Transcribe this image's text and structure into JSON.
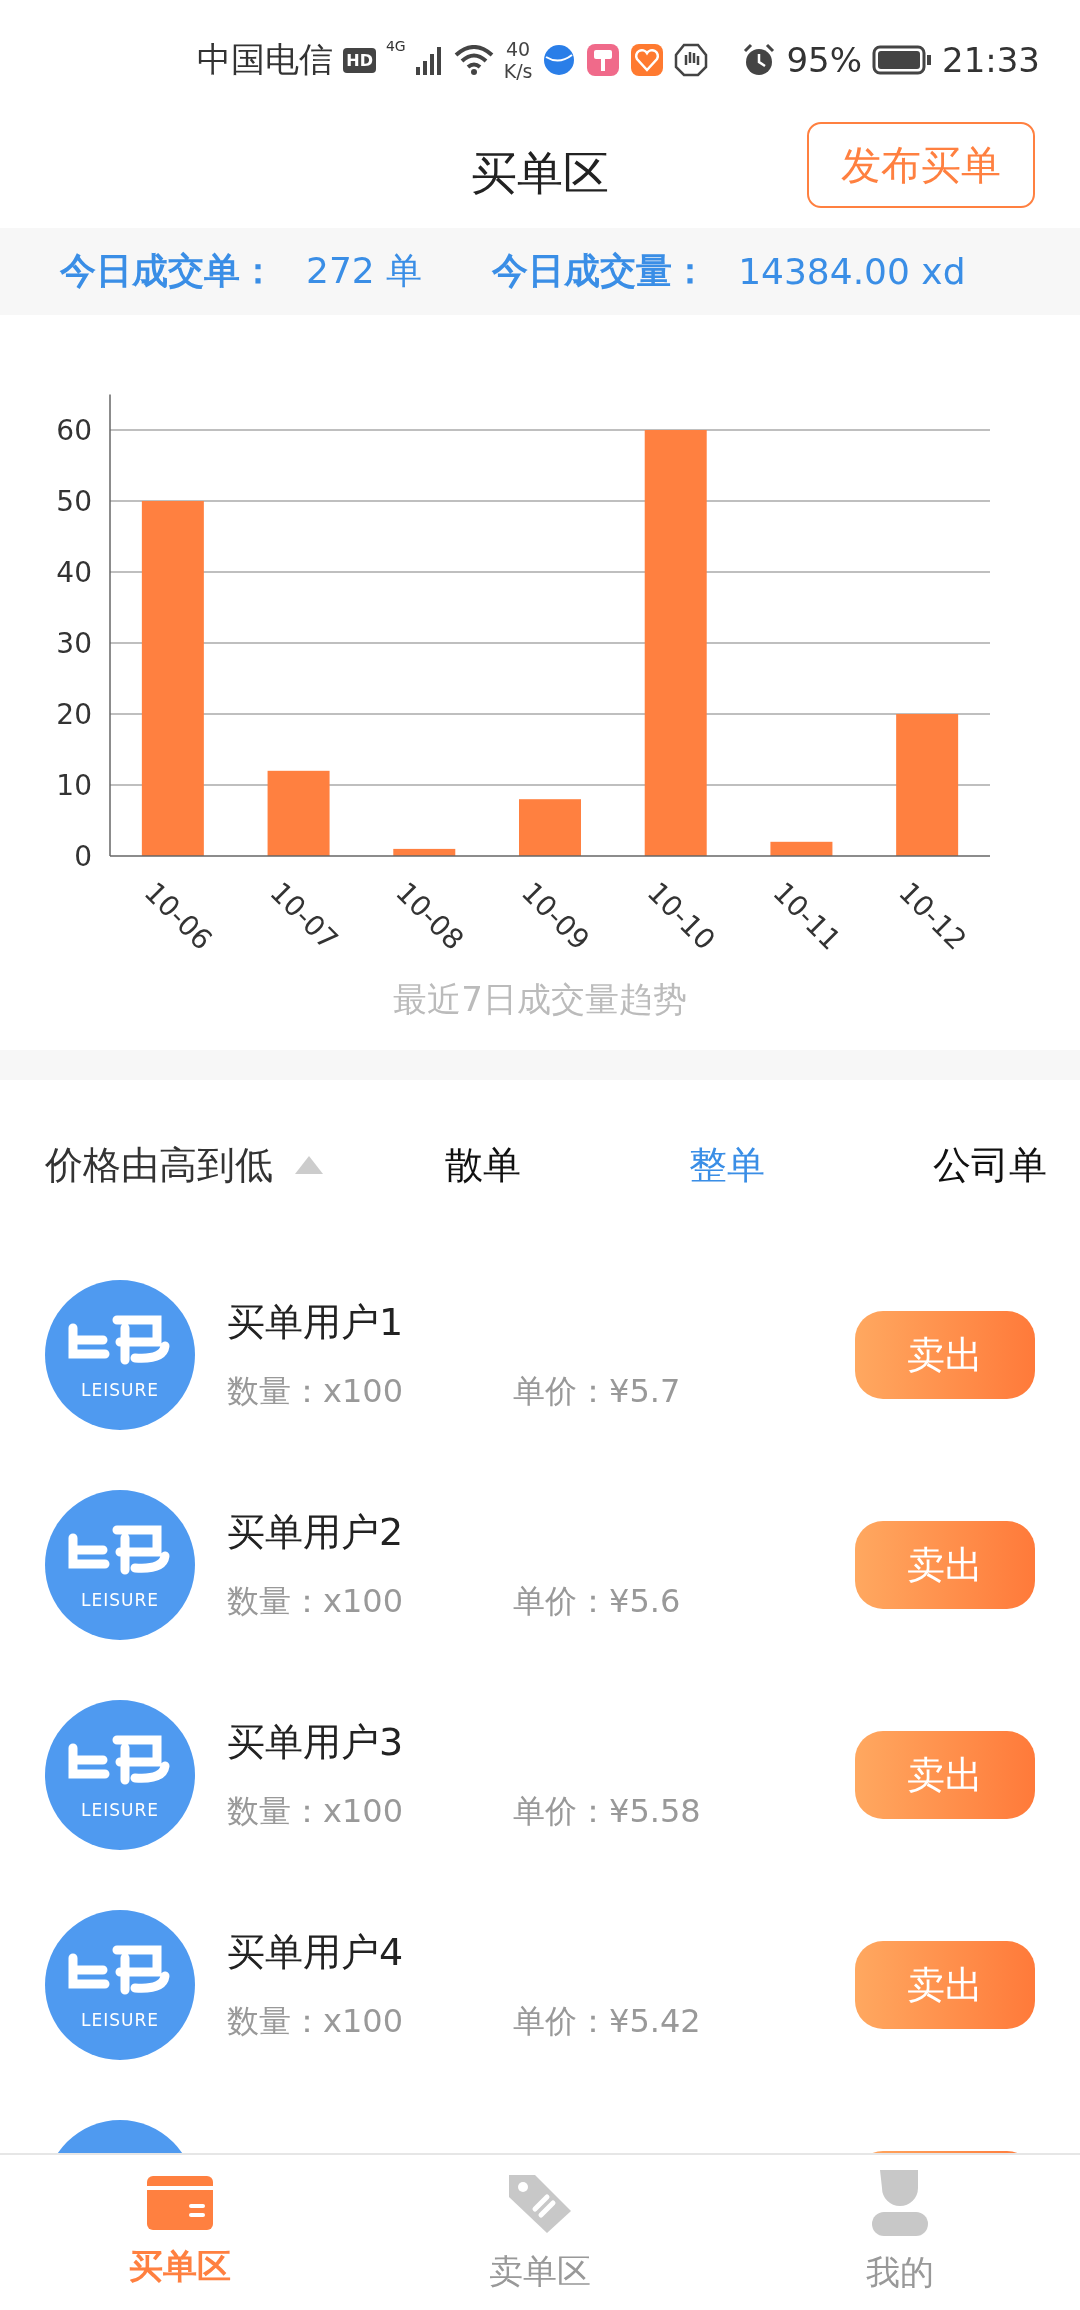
{
  "status_bar": {
    "carrier": "中国电信",
    "hd": "HD",
    "network": "4G",
    "speed_value": "40",
    "speed_unit": "K/s",
    "battery": "95%",
    "time": "21:33"
  },
  "header": {
    "title": "买单区",
    "action": "发布买单"
  },
  "stats": [
    {
      "label": "今日成交单：",
      "value": "272 单"
    },
    {
      "label": "今日成交量：",
      "value": "14384.00 xd"
    }
  ],
  "chart": {
    "caption": "最近7日成交量趋势",
    "chart_data": {
      "type": "bar",
      "categories": [
        "10-06",
        "10-07",
        "10-08",
        "10-09",
        "10-10",
        "10-11",
        "10-12"
      ],
      "series": [
        {
          "color": "#ff8040",
          "values": [
            50,
            12,
            1,
            8,
            60,
            2,
            20
          ]
        }
      ],
      "ylim": [
        0,
        65
      ],
      "grid": true,
      "yticks": [
        0,
        10,
        20,
        30,
        40,
        50,
        60
      ]
    }
  },
  "filters": {
    "sort": {
      "label": "价格由高到低"
    },
    "tabs": [
      {
        "label": "散单",
        "selected": false
      },
      {
        "label": "整单",
        "selected": true
      },
      {
        "label": "公司单",
        "selected": false
      }
    ]
  },
  "orders": [
    {
      "name": "买单用户1",
      "logo_text": "LEISURE",
      "quantity": "数量：x100",
      "price": "单价：¥5.7",
      "action": "卖出"
    },
    {
      "name": "买单用户2",
      "logo_text": "LEISURE",
      "quantity": "数量：x100",
      "price": "单价：¥5.6",
      "action": "卖出"
    },
    {
      "name": "买单用户3",
      "logo_text": "LEISURE",
      "quantity": "数量：x100",
      "price": "单价：¥5.58",
      "action": "卖出"
    },
    {
      "name": "买单用户4",
      "logo_text": "LEISURE",
      "quantity": "数量：x100",
      "price": "单价：¥5.42",
      "action": "卖出"
    }
  ],
  "more_orders_below": true,
  "nav": [
    {
      "kind": "card",
      "label": "买单区",
      "selected": true
    },
    {
      "kind": "tag",
      "label": "卖单区",
      "selected": false
    },
    {
      "kind": "person",
      "label": "我的",
      "selected": false
    }
  ]
}
